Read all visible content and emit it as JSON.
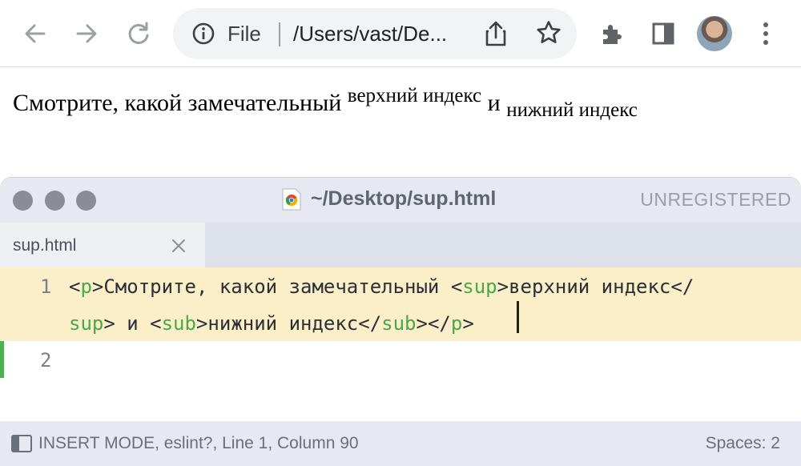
{
  "browser": {
    "omnibox": {
      "scheme": "File",
      "url": "/Users/vast/De..."
    },
    "icons": [
      "back-icon",
      "forward-icon",
      "reload-icon",
      "info-icon",
      "share-icon",
      "star-icon",
      "extensions-icon",
      "side-panel-icon",
      "avatar",
      "menu-icon"
    ]
  },
  "page": {
    "text_main": "Смотрите, какой замечательный ",
    "text_sup": "верхний индекс",
    "text_and": " и ",
    "text_sub": "нижний индекс"
  },
  "editor": {
    "title": "~/Desktop/sup.html",
    "unregistered": "UNREGISTERED",
    "tab_label": "sup.html",
    "lines": {
      "line1_number": "1",
      "line2_number": "2",
      "l1": {
        "t1": "<",
        "t2": "p",
        "t3": ">Смотрите, какой замечательный <",
        "t4": "sup",
        "t5": ">верхний индекс</"
      },
      "l2": {
        "t1": "sup",
        "t2": "> и <",
        "t3": "sub",
        "t4": ">нижний индекс</",
        "t5": "sub",
        "t6": "></",
        "t7": "p",
        "t8": ">"
      }
    },
    "status": {
      "left": "INSERT MODE, eslint?, Line 1, Column 90",
      "right": "Spaces: 2"
    },
    "colors": {
      "tag": "#4aa84a",
      "active_line": "#faefc8",
      "modified_gutter": "#4caf50"
    }
  }
}
